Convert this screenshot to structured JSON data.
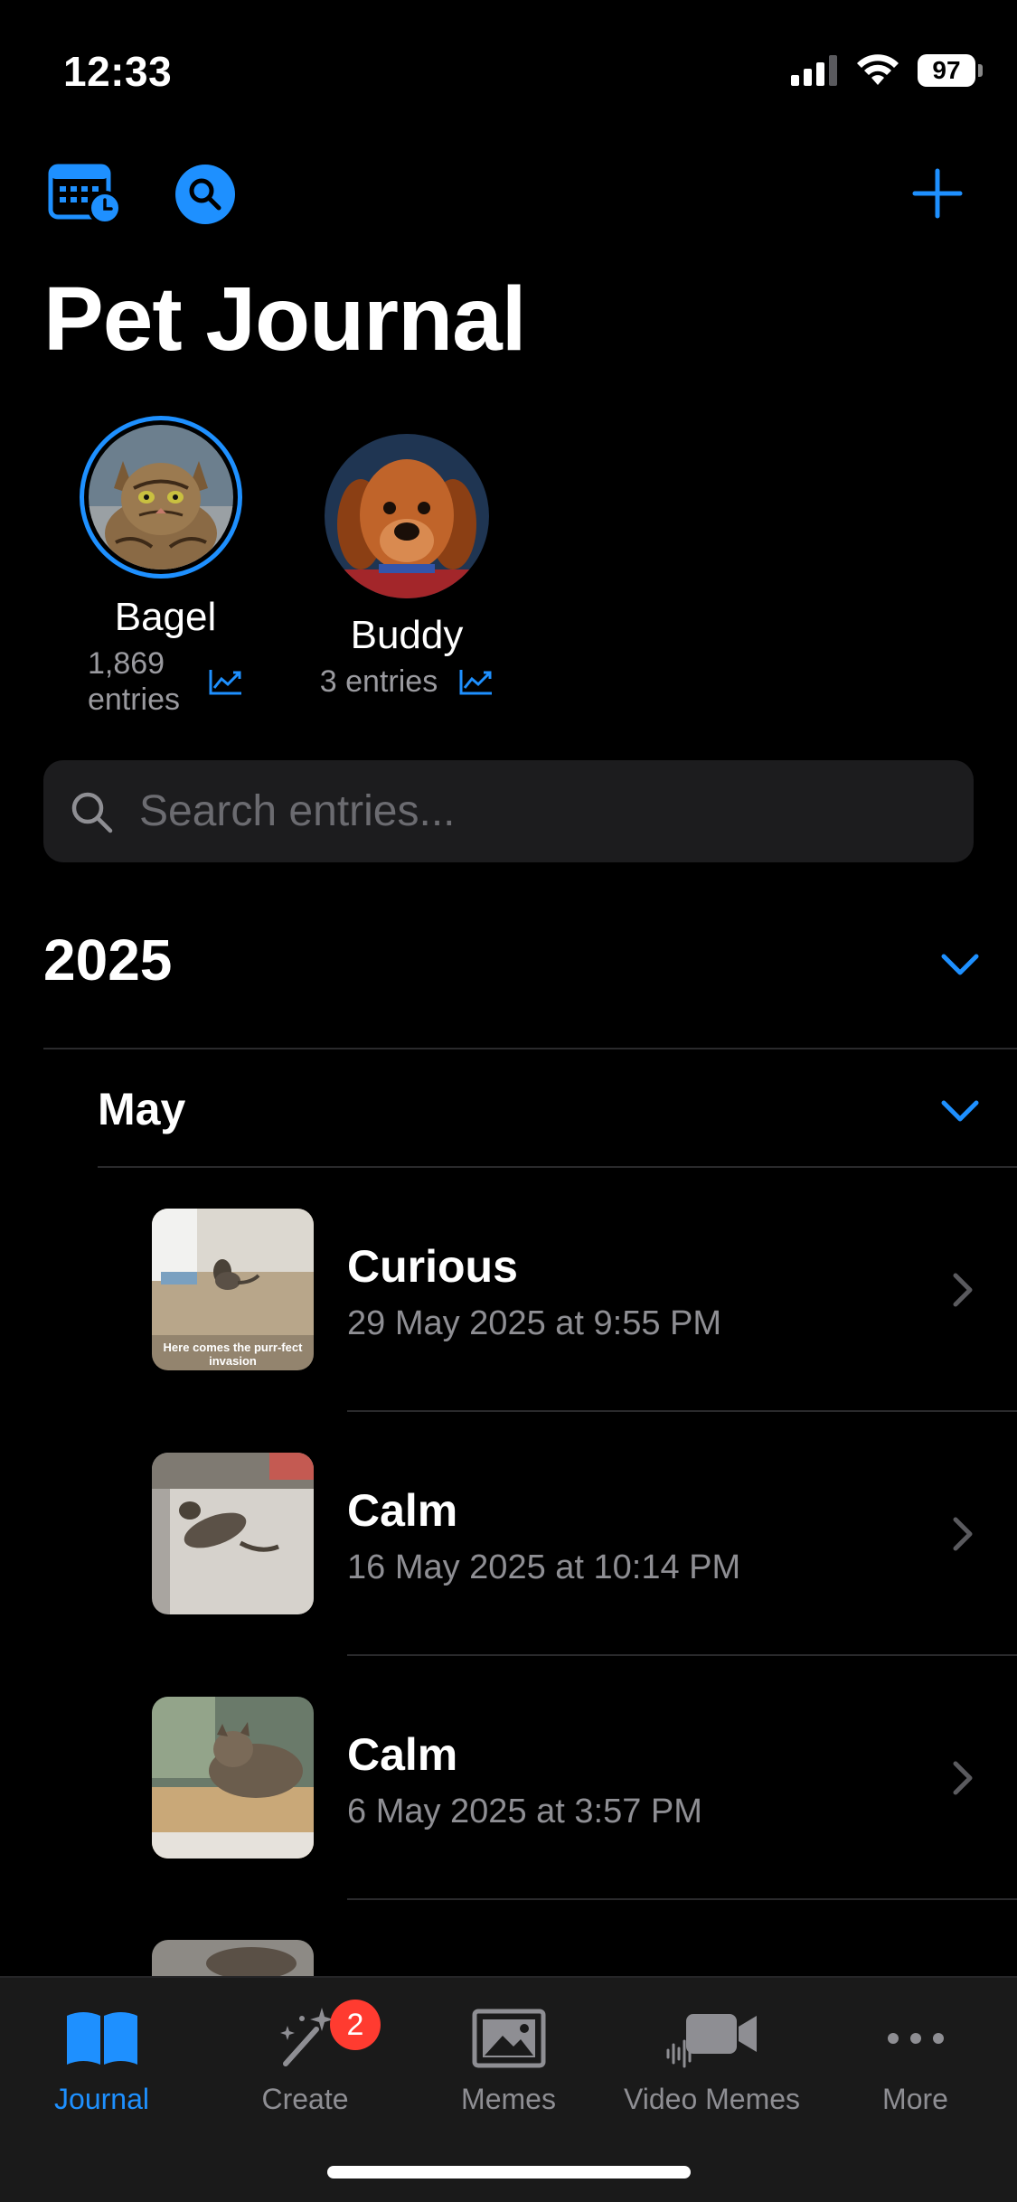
{
  "status_bar": {
    "time": "12:33",
    "battery": "97"
  },
  "header": {
    "title": "Pet Journal"
  },
  "pets": [
    {
      "name": "Bagel",
      "entries_line1": "1,869",
      "entries_line2": "entries"
    },
    {
      "name": "Buddy",
      "entries": "3 entries"
    }
  ],
  "search": {
    "placeholder": "Search entries..."
  },
  "timeline": {
    "year": "2025",
    "month": "May",
    "entries": [
      {
        "title": "Curious",
        "date": "29 May 2025 at 9:55 PM",
        "caption": "Here comes the purr-fect invasion"
      },
      {
        "title": "Calm",
        "date": "16 May 2025 at 10:14 PM"
      },
      {
        "title": "Calm",
        "date": "6 May 2025 at 3:57 PM"
      }
    ]
  },
  "tabbar": {
    "tabs": [
      {
        "label": "Journal",
        "icon": "book-icon"
      },
      {
        "label": "Create",
        "icon": "magic-wand-icon",
        "badge": "2"
      },
      {
        "label": "Memes",
        "icon": "photo-icon"
      },
      {
        "label": "Video Memes",
        "icon": "video-icon"
      },
      {
        "label": "More",
        "icon": "ellipsis-icon"
      }
    ]
  },
  "colors": {
    "accent": "#1e90ff",
    "badge": "#ff3b30",
    "background": "#000000"
  }
}
